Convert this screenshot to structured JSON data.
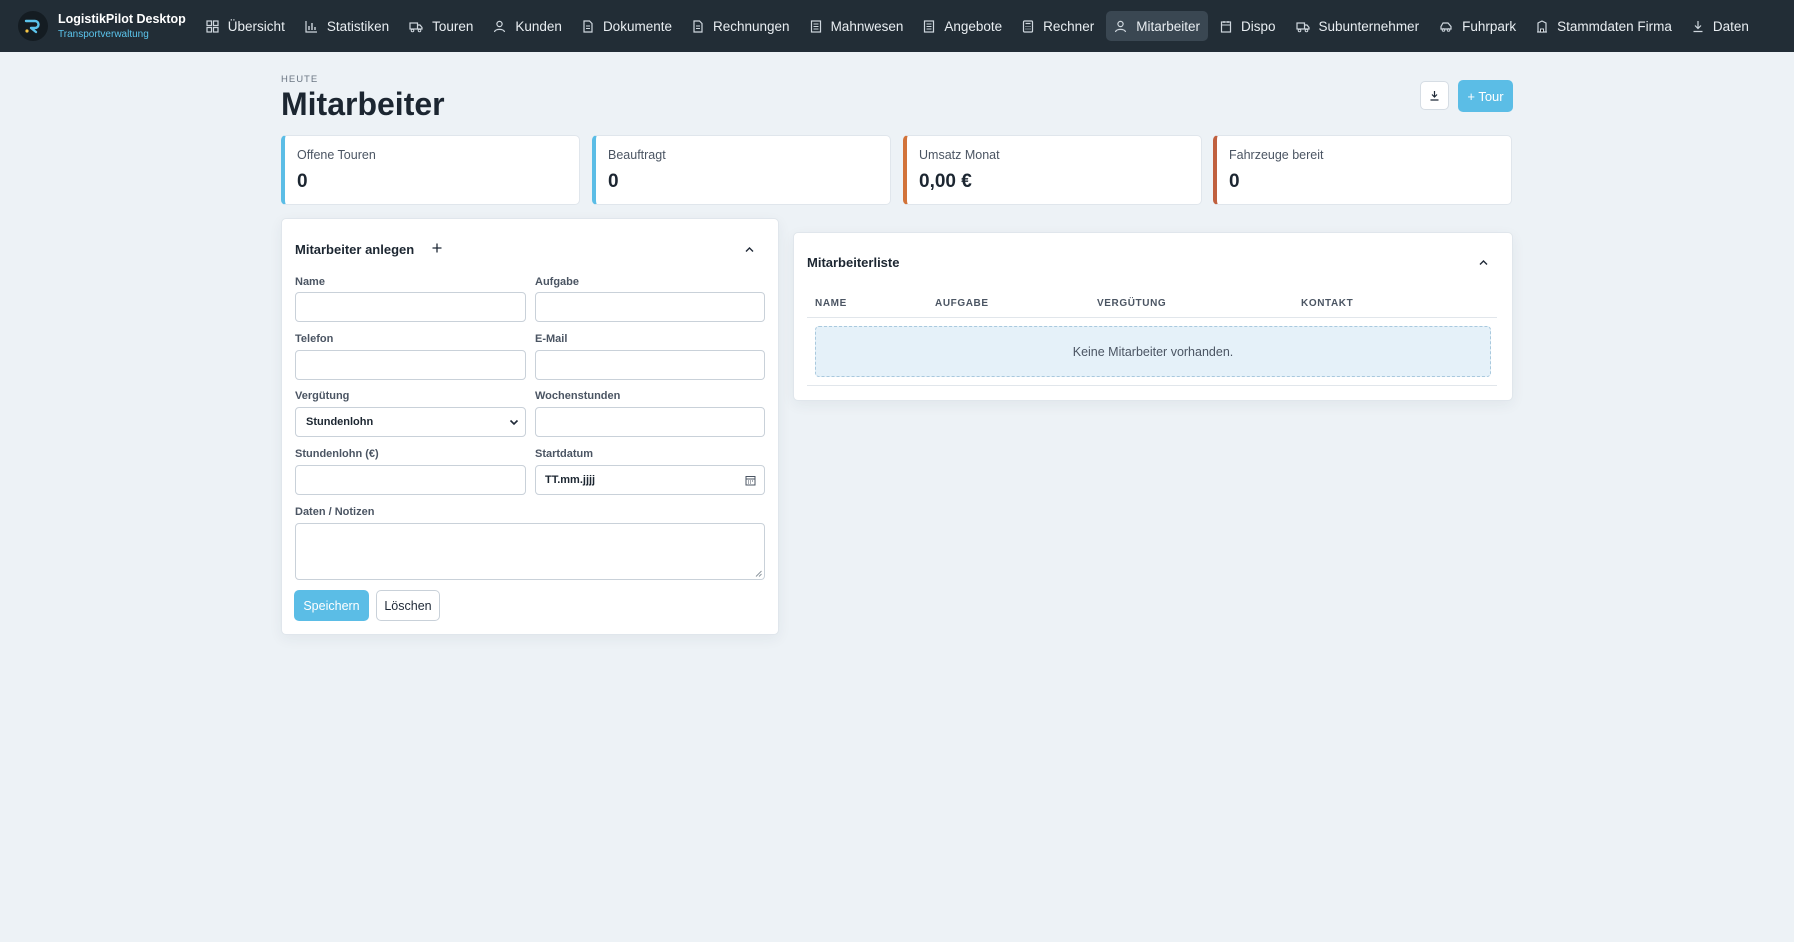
{
  "app": {
    "title": "LogistikPilot Desktop",
    "subtitle": "Transportverwaltung"
  },
  "nav": {
    "items": [
      {
        "label": "Übersicht",
        "icon": "grid-icon",
        "active": false
      },
      {
        "label": "Statistiken",
        "icon": "bar-chart-icon",
        "active": false
      },
      {
        "label": "Touren",
        "icon": "truck-icon",
        "active": false
      },
      {
        "label": "Kunden",
        "icon": "user-icon",
        "active": false
      },
      {
        "label": "Dokumente",
        "icon": "document-icon",
        "active": false
      },
      {
        "label": "Rechnungen",
        "icon": "document-icon",
        "active": false
      },
      {
        "label": "Mahnwesen",
        "icon": "list-icon",
        "active": false
      },
      {
        "label": "Angebote",
        "icon": "list-icon",
        "active": false
      },
      {
        "label": "Rechner",
        "icon": "calculator-icon",
        "active": false
      },
      {
        "label": "Mitarbeiter",
        "icon": "user-icon",
        "active": true
      },
      {
        "label": "Dispo",
        "icon": "calendar-icon",
        "active": false
      },
      {
        "label": "Subunternehmer",
        "icon": "truck-icon",
        "active": false
      },
      {
        "label": "Fuhrpark",
        "icon": "car-icon",
        "active": false
      },
      {
        "label": "Stammdaten Firma",
        "icon": "building-icon",
        "active": false
      },
      {
        "label": "Daten",
        "icon": "download-icon",
        "active": false
      }
    ]
  },
  "header": {
    "eyebrow": "HEUTE",
    "title": "Mitarbeiter",
    "new_tour_label": "+ Tour",
    "download_icon": "download-icon"
  },
  "kpis": [
    {
      "label": "Offene Touren",
      "value": "0",
      "color": "#5bbde6"
    },
    {
      "label": "Beauftragt",
      "value": "0",
      "color": "#5bbde6"
    },
    {
      "label": "Umsatz Monat",
      "value": "0,00 €",
      "color": "#d2733a"
    },
    {
      "label": "Fahrzeuge bereit",
      "value": "0",
      "color": "#c0603f"
    }
  ],
  "form": {
    "title": "Mitarbeiter anlegen",
    "name_label": "Name",
    "name_value": "",
    "task_label": "Aufgabe",
    "task_value": "",
    "phone_label": "Telefon",
    "phone_value": "",
    "email_label": "E-Mail",
    "email_value": "",
    "pay_label": "Vergütung",
    "pay_selected": "Stundenlohn",
    "hours_label": "Wochenstunden",
    "hours_value": "",
    "wage_label": "Stundenlohn (€)",
    "wage_value": "",
    "start_label": "Startdatum",
    "start_placeholder": "TT.mm.jjjj",
    "notes_label": "Daten / Notizen",
    "notes_value": "",
    "save_label": "Speichern",
    "delete_label": "Löschen"
  },
  "list": {
    "title": "Mitarbeiterliste",
    "columns": [
      "NAME",
      "AUFGABE",
      "VERGÜTUNG",
      "KONTAKT"
    ],
    "empty_text": "Keine Mitarbeiter vorhanden."
  },
  "colors": {
    "topbar": "#222d36",
    "accent": "#5bbde6",
    "background": "#edf2f6"
  }
}
